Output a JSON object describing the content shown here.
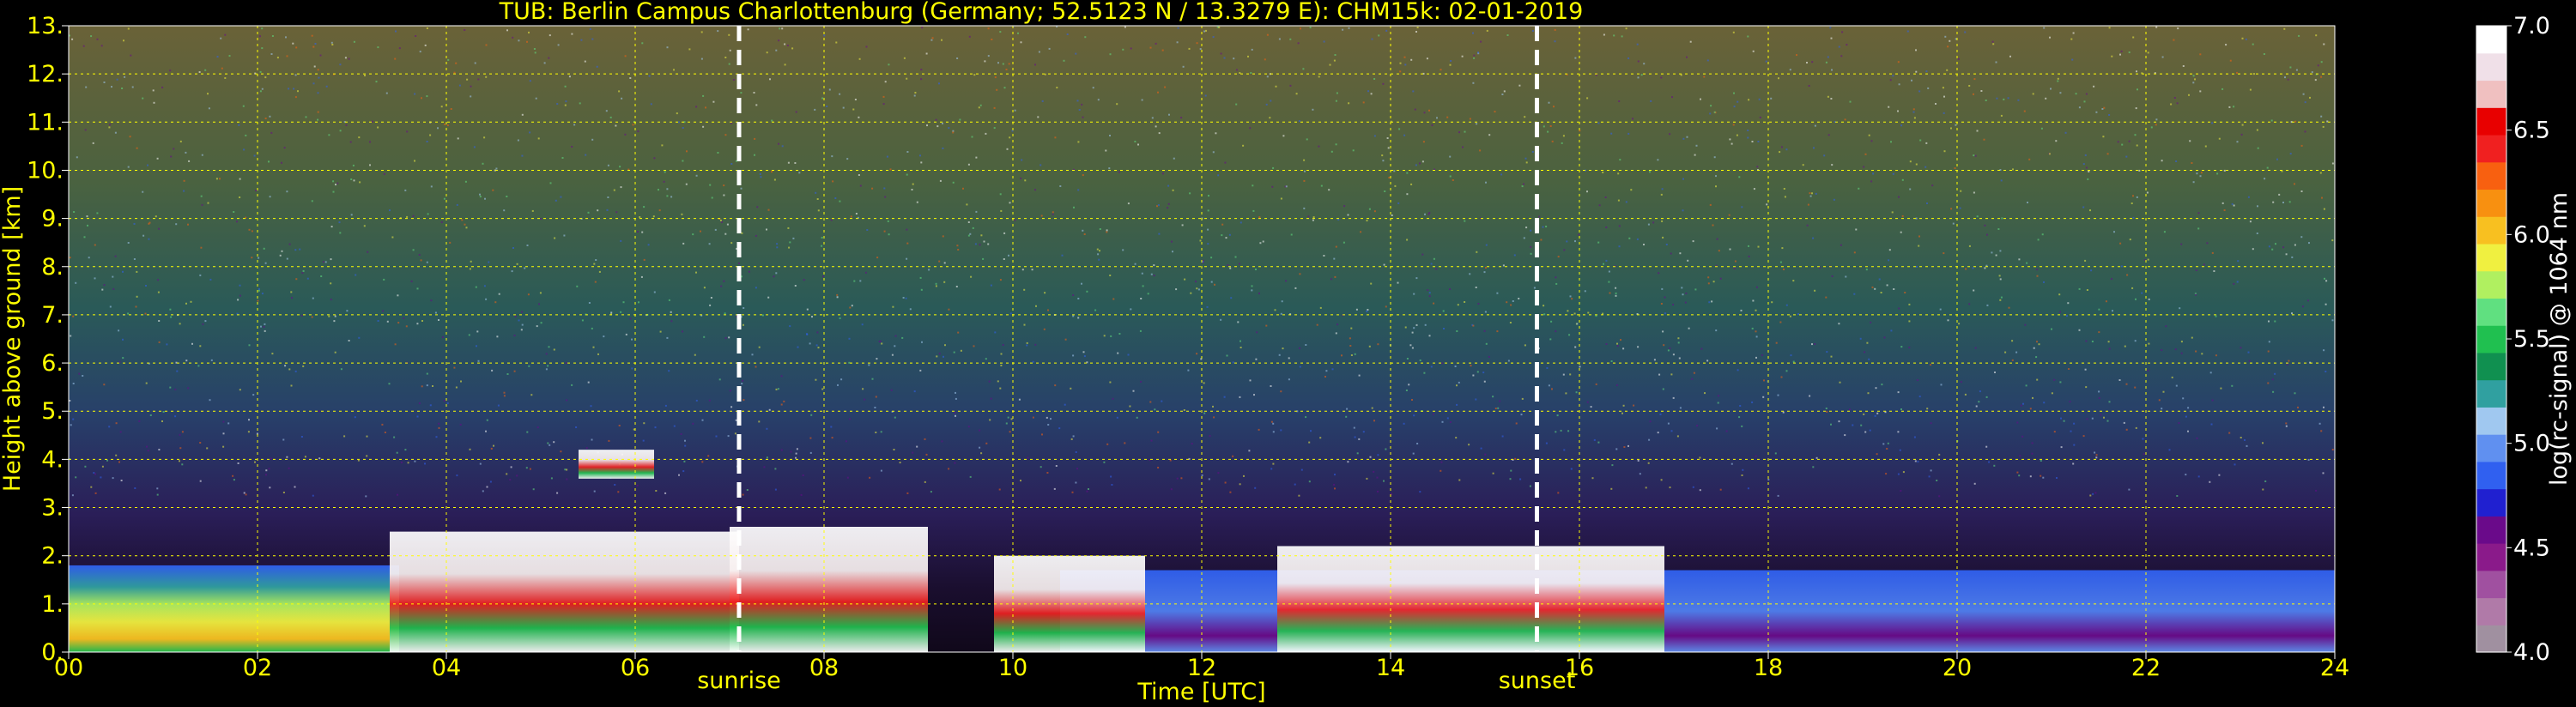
{
  "title": "TUB: Berlin Campus Charlottenburg (Germany; 52.5123 N / 13.3279 E):    CHM15k: 02-01-2019",
  "colors": {
    "axis_text": "#ffff00",
    "grid": "#ffff00",
    "event_line": "#ffffff",
    "background": "#000000",
    "colorbar_label": "#ffffff"
  },
  "chart_data": {
    "type": "heatmap",
    "title": "TUB: Berlin Campus Charlottenburg (Germany; 52.5123 N / 13.3279 E):    CHM15k: 02-01-2019",
    "xlabel": "Time [UTC]",
    "ylabel": "Height above ground [km]",
    "xlim": [
      0,
      24
    ],
    "ylim": [
      0,
      13
    ],
    "xticks": [
      0,
      2,
      4,
      6,
      8,
      10,
      12,
      14,
      16,
      18,
      20,
      22,
      24
    ],
    "xtick_labels": [
      "00",
      "02",
      "04",
      "06",
      "08",
      "10",
      "12",
      "14",
      "16",
      "18",
      "20",
      "22",
      "24"
    ],
    "yticks": [
      0,
      1,
      2,
      3,
      4,
      5,
      6,
      7,
      8,
      9,
      10,
      11,
      12,
      13
    ],
    "ytick_labels": [
      "0.",
      "1.",
      "2.",
      "3.",
      "4.",
      "5.",
      "6.",
      "7.",
      "8.",
      "9.",
      "10.",
      "11.",
      "12.",
      "13."
    ],
    "grid": true,
    "events": [
      {
        "label": "sunrise",
        "time": 7.1
      },
      {
        "label": "sunset",
        "time": 15.55
      }
    ],
    "colorbar": {
      "label": "log(rc-signal) @ 1064 nm",
      "range": [
        4.0,
        7.0
      ],
      "ticks": [
        4.0,
        4.5,
        5.0,
        5.5,
        6.0,
        6.5,
        7.0
      ],
      "tick_labels": [
        "4.0",
        "4.5",
        "5.0",
        "5.5",
        "6.0",
        "6.5",
        "7.0"
      ],
      "colors": [
        "#a090a0",
        "#b07aa8",
        "#a050a0",
        "#8a1a8a",
        "#6a0a8a",
        "#2020d0",
        "#3060f0",
        "#6090f0",
        "#a0c8f0",
        "#30a0a0",
        "#109050",
        "#20c050",
        "#60e080",
        "#b0f060",
        "#f0f040",
        "#f8c020",
        "#f89010",
        "#f86010",
        "#f02020",
        "#e80000",
        "#f0c0c0",
        "#f0e0e8",
        "#ffffff"
      ]
    },
    "regions": [
      {
        "type": "boundary_layer_aerosol",
        "time": [
          0,
          3.5
        ],
        "height_km": [
          0,
          1.8
        ]
      },
      {
        "type": "cloud",
        "time": [
          3.4,
          7.1
        ],
        "height_km": [
          0,
          2.5
        ]
      },
      {
        "type": "cloud",
        "time": [
          5.4,
          6.2
        ],
        "height_km": [
          3.6,
          4.2
        ]
      },
      {
        "type": "cloud",
        "time": [
          7.0,
          9.1
        ],
        "height_km": [
          0,
          2.6
        ]
      },
      {
        "type": "cloud",
        "time": [
          9.8,
          11.4
        ],
        "height_km": [
          0,
          2.0
        ]
      },
      {
        "type": "cloud",
        "time": [
          12.8,
          16.9
        ],
        "height_km": [
          0,
          2.2
        ]
      },
      {
        "type": "aerosol_layer",
        "time": [
          10.5,
          24
        ],
        "height_km": [
          0,
          1.7
        ]
      }
    ]
  }
}
